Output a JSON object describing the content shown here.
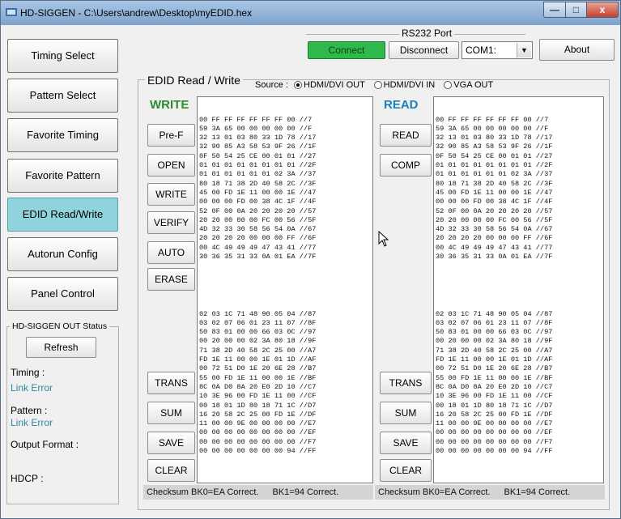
{
  "window": {
    "title": "HD-SIGGEN  - C:\\Users\\andrew\\Desktop\\myEDID.hex",
    "min_glyph": "—",
    "max_glyph": "□",
    "close_glyph": "x"
  },
  "nav": [
    "Timing Select",
    "Pattern Select",
    "Favorite Timing",
    "Favorite Pattern",
    "EDID Read/Write",
    "Autorun Config",
    "Panel Control"
  ],
  "serial": {
    "group_label": "RS232 Port",
    "connect_label": "Connect",
    "disconnect_label": "Disconnect",
    "port_value": "COM1:",
    "about_label": "About"
  },
  "status_panel": {
    "title": "HD-SIGGEN OUT Status",
    "refresh_label": "Refresh",
    "timing_label": "Timing :",
    "timing_value": "Link Error",
    "pattern_label": "Pattern :",
    "pattern_value": "Link Error",
    "output_label": "Output Format :",
    "hdcp_label": "HDCP :"
  },
  "edid": {
    "group_label": "EDID Read / Write",
    "source_label": "Source :",
    "source_options": [
      "HDMI/DVI OUT",
      "HDMI/DVI IN",
      "VGA OUT"
    ],
    "selected_source": "HDMI/DVI OUT",
    "write_heading": "WRITE",
    "read_heading": "READ",
    "write_buttons": [
      "Pre-F",
      "OPEN",
      "WRITE",
      "VERIFY",
      "AUTO",
      "ERASE"
    ],
    "read_buttons": [
      "READ",
      "COMP"
    ],
    "bottom_buttons": [
      "TRANS",
      "SUM",
      "SAVE",
      "CLEAR"
    ],
    "write_status_1": "Checksum BK0=EA Correct.",
    "write_status_2": "BK1=94 Correct.",
    "read_status_1": "Checksum BK0=EA Correct.",
    "read_status_2": "BK1=94 Correct.",
    "block0": [
      "00 FF FF FF FF FF FF 00 //7",
      "59 3A 65 00 00 00 00 00 //F",
      "32 13 01 03 80 33 1D 78 //17",
      "32 90 85 A3 58 53 9F 26 //1F",
      "0F 50 54 25 CE 00 01 01 //27",
      "01 01 01 01 01 01 01 01 //2F",
      "01 01 01 01 01 01 02 3A //37",
      "80 18 71 38 2D 40 58 2C //3F",
      "45 00 FD 1E 11 00 00 1E //47",
      "00 00 00 FD 00 38 4C 1F //4F",
      "52 0F 00 0A 20 20 20 20 //57",
      "20 20 00 00 00 FC 00 56 //5F",
      "4D 32 33 30 58 56 54 0A //67",
      "20 20 20 20 00 00 00 FF //6F",
      "00 4C 49 49 49 47 43 41 //77",
      "30 36 35 31 33 0A 01 EA //7F"
    ],
    "block1": [
      "02 03 1C 71 48 90 05 04 //87",
      "03 02 07 06 01 23 11 07 //8F",
      "50 83 01 00 00 66 03 0C //97",
      "00 20 00 00 02 3A 80 18 //9F",
      "71 38 2D 40 58 2C 25 00 //A7",
      "FD 1E 11 00 00 1E 01 1D //AF",
      "00 72 51 D0 1E 20 6E 28 //B7",
      "55 00 FD 1E 11 00 00 1E //BF",
      "8C 0A D0 8A 20 E0 2D 10 //C7",
      "10 3E 96 00 FD 1E 11 00 //CF",
      "00 18 01 1D 80 18 71 1C //D7",
      "16 20 58 2C 25 00 FD 1E //DF",
      "11 00 00 9E 00 00 00 00 //E7",
      "00 00 00 00 00 00 00 00 //EF",
      "00 00 00 00 00 00 00 00 //F7",
      "00 00 00 00 00 00 00 94 //FF"
    ]
  }
}
